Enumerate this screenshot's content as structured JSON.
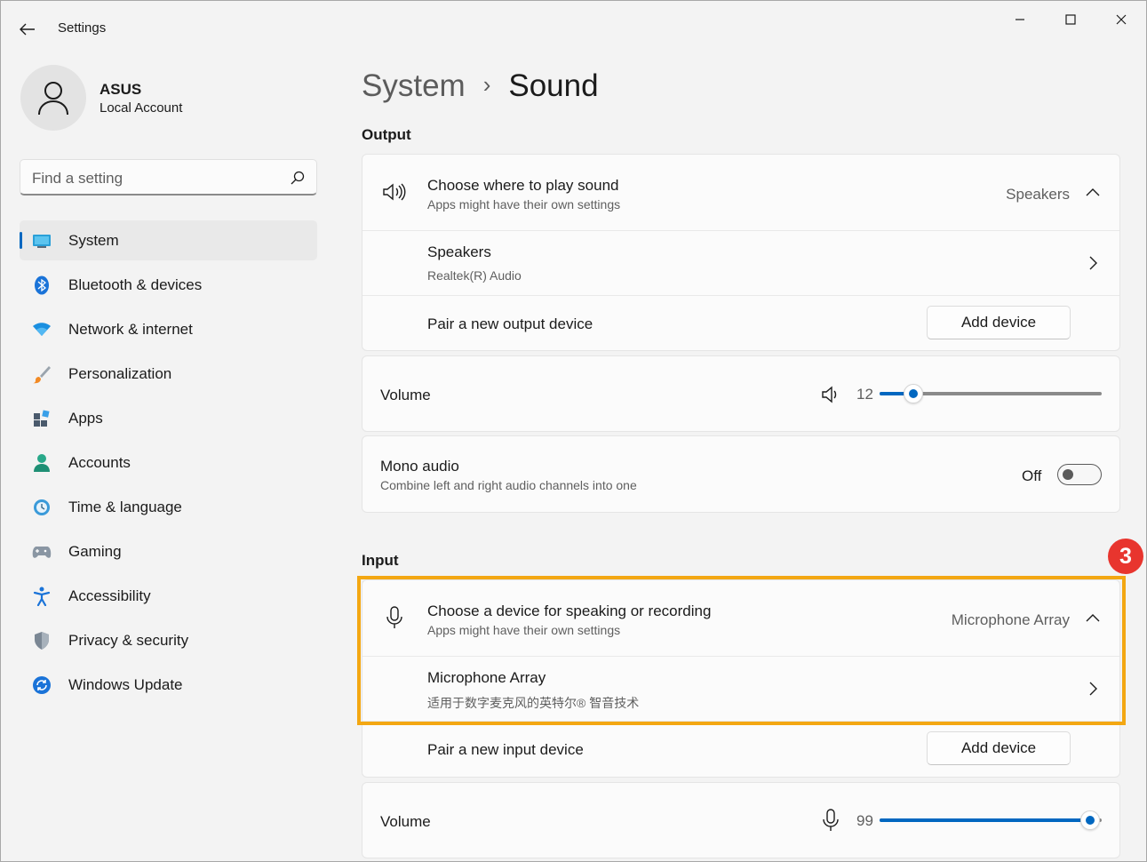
{
  "app": {
    "title": "Settings"
  },
  "profile": {
    "name": "ASUS",
    "account_type": "Local Account"
  },
  "search": {
    "placeholder": "Find a setting"
  },
  "sidebar": {
    "items": [
      {
        "label": "System",
        "icon": "system-icon",
        "selected": true
      },
      {
        "label": "Bluetooth & devices",
        "icon": "bluetooth-icon"
      },
      {
        "label": "Network & internet",
        "icon": "wifi-icon"
      },
      {
        "label": "Personalization",
        "icon": "brush-icon"
      },
      {
        "label": "Apps",
        "icon": "apps-icon"
      },
      {
        "label": "Accounts",
        "icon": "accounts-icon"
      },
      {
        "label": "Time & language",
        "icon": "time-language-icon"
      },
      {
        "label": "Gaming",
        "icon": "gamepad-icon"
      },
      {
        "label": "Accessibility",
        "icon": "accessibility-icon"
      },
      {
        "label": "Privacy & security",
        "icon": "shield-icon"
      },
      {
        "label": "Windows Update",
        "icon": "update-icon"
      }
    ]
  },
  "breadcrumb": {
    "parent": "System",
    "separator": "›",
    "current": "Sound"
  },
  "output": {
    "section_title": "Output",
    "choose": {
      "title": "Choose where to play sound",
      "subtitle": "Apps might have their own settings",
      "value": "Speakers"
    },
    "device": {
      "title": "Speakers",
      "subtitle": "Realtek(R) Audio"
    },
    "pair": {
      "title": "Pair a new output device",
      "button": "Add device"
    },
    "volume": {
      "label": "Volume",
      "value": "12",
      "level": 0.12
    },
    "mono": {
      "title": "Mono audio",
      "subtitle": "Combine left and right audio channels into one",
      "state": "Off"
    }
  },
  "input": {
    "section_title": "Input",
    "choose": {
      "title": "Choose a device for speaking or recording",
      "subtitle": "Apps might have their own settings",
      "value": "Microphone Array"
    },
    "device": {
      "title": "Microphone Array",
      "subtitle": "适用于数字麦克风的英特尔® 智音技术"
    },
    "pair": {
      "title": "Pair a new input device",
      "button": "Add device"
    },
    "volume": {
      "label": "Volume",
      "value": "99",
      "level": 0.99
    }
  },
  "annotation": {
    "step": "3",
    "color": "#f3a712",
    "badge_color": "#e8352e"
  },
  "colors": {
    "accent": "#0067c0",
    "background": "#f3f3f3",
    "card": "#fbfbfb"
  }
}
